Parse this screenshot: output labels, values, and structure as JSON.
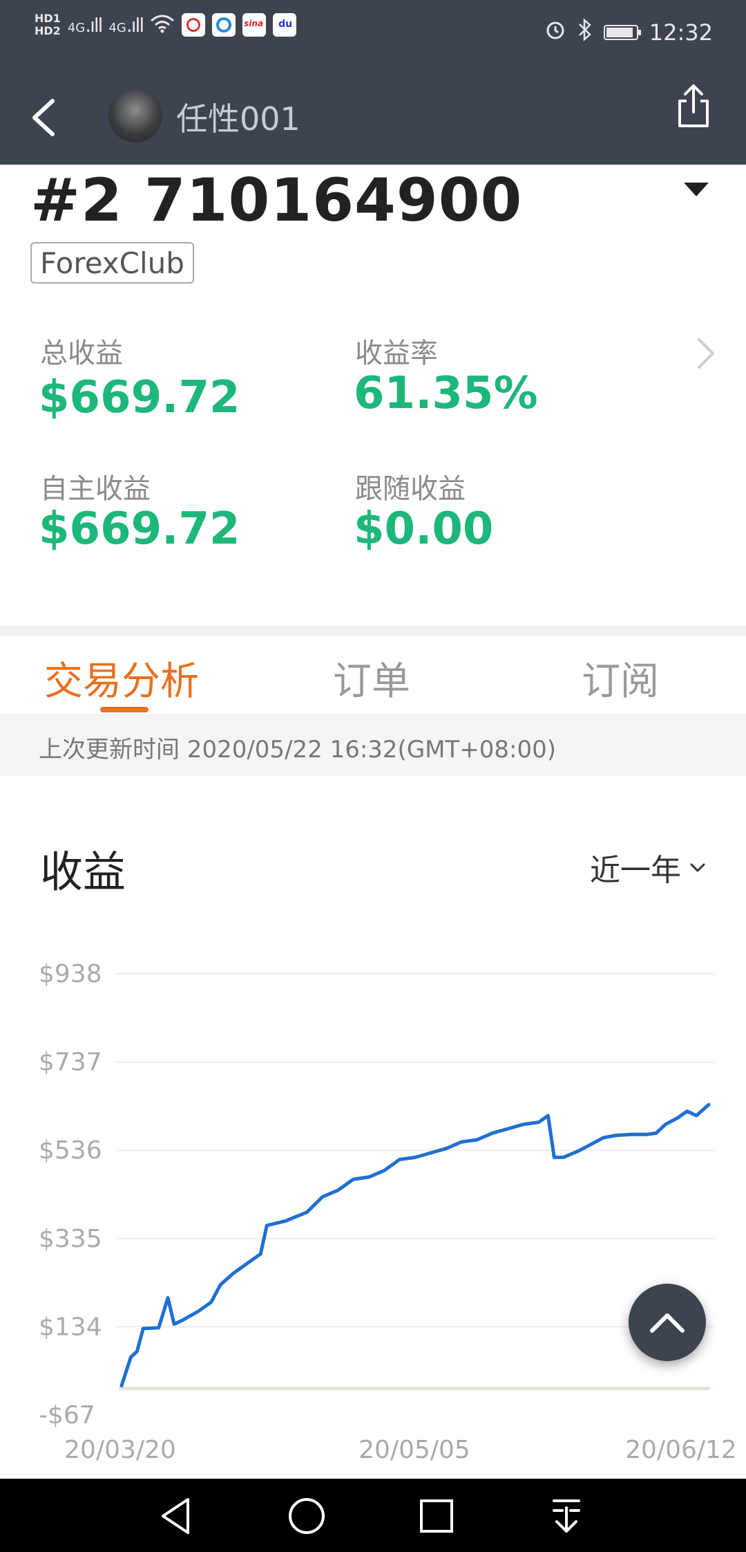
{
  "status_bar": {
    "network": "4G",
    "hd1": "HD1",
    "hd2": "HD2",
    "time": "12:32"
  },
  "app_bar": {
    "username": "任性001"
  },
  "account": {
    "title": "#2 710164900",
    "broker": "ForexClub"
  },
  "stats": {
    "total_profit_label": "总收益",
    "total_profit_value": "$669.72",
    "yield_label": "收益率",
    "yield_value": "61.35%",
    "own_profit_label": "自主收益",
    "own_profit_value": "$669.72",
    "follow_profit_label": "跟随收益",
    "follow_profit_value": "$0.00"
  },
  "tabs": [
    {
      "label": "交易分析",
      "active": true
    },
    {
      "label": "订单",
      "active": false
    },
    {
      "label": "订阅",
      "active": false
    }
  ],
  "update": {
    "text": "上次更新时间 2020/05/22 16:32(GMT+08:00)"
  },
  "chart_section": {
    "title": "收益",
    "range": "近一年"
  },
  "colors": {
    "accent": "#e8701e",
    "profit_green": "#1db77a",
    "line_blue": "#1f6fd1",
    "header_bg": "#3d4450"
  },
  "chart_data": {
    "type": "line",
    "title": "收益",
    "yticks": [
      "$938",
      "$737",
      "$536",
      "$335",
      "$134",
      "-$67"
    ],
    "xticks": [
      "20/03/20",
      "20/05/05",
      "20/06/12"
    ],
    "ylim": [
      -67,
      938
    ],
    "grid": true,
    "series": [
      {
        "values": [
          [
            0,
            0
          ],
          [
            3,
            65
          ],
          [
            5,
            78
          ],
          [
            7,
            130
          ],
          [
            12,
            132
          ],
          [
            15,
            200
          ],
          [
            17,
            140
          ],
          [
            20,
            150
          ],
          [
            25,
            170
          ],
          [
            29,
            190
          ],
          [
            32,
            230
          ],
          [
            36,
            255
          ],
          [
            40,
            275
          ],
          [
            45,
            300
          ],
          [
            47,
            365
          ],
          [
            53,
            375
          ],
          [
            60,
            395
          ],
          [
            65,
            430
          ],
          [
            70,
            445
          ],
          [
            75,
            470
          ],
          [
            80,
            475
          ],
          [
            85,
            490
          ],
          [
            90,
            515
          ],
          [
            95,
            520
          ],
          [
            100,
            530
          ],
          [
            105,
            540
          ],
          [
            110,
            555
          ],
          [
            115,
            560
          ],
          [
            120,
            575
          ],
          [
            125,
            585
          ],
          [
            130,
            595
          ],
          [
            135,
            600
          ],
          [
            138,
            615
          ],
          [
            140,
            520
          ],
          [
            143,
            520
          ],
          [
            148,
            535
          ],
          [
            152,
            550
          ],
          [
            156,
            565
          ],
          [
            160,
            570
          ],
          [
            165,
            572
          ],
          [
            170,
            572
          ],
          [
            173,
            575
          ],
          [
            176,
            595
          ],
          [
            180,
            610
          ],
          [
            183,
            625
          ],
          [
            186,
            615
          ],
          [
            190,
            640
          ]
        ]
      }
    ]
  }
}
